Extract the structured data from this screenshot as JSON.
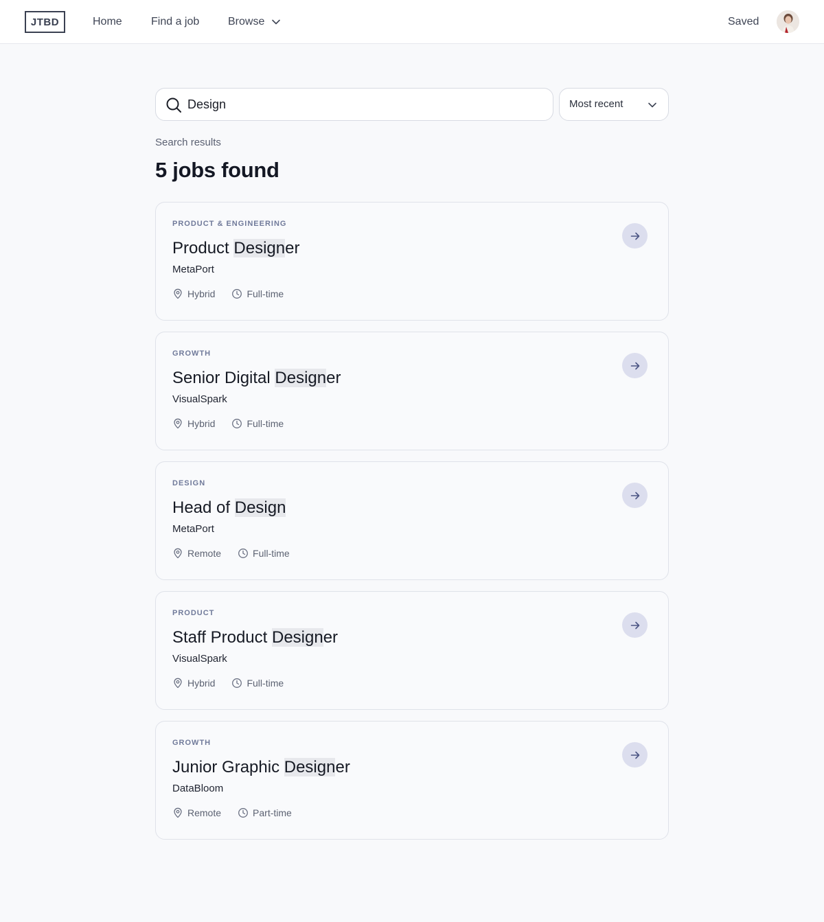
{
  "nav": {
    "logo": "JTBD",
    "home": "Home",
    "find_job": "Find a job",
    "browse": "Browse",
    "saved": "Saved"
  },
  "search": {
    "value": "Design",
    "sort": "Most recent"
  },
  "results": {
    "label": "Search results",
    "count": "5 jobs found"
  },
  "jobs": [
    {
      "category": "Product & Engineering",
      "title_pre": "Product ",
      "title_hl": "Design",
      "title_post": "er",
      "company": "MetaPort",
      "location": "Hybrid",
      "type": "Full-time"
    },
    {
      "category": "Growth",
      "title_pre": "Senior Digital ",
      "title_hl": "Design",
      "title_post": "er",
      "company": "VisualSpark",
      "location": "Hybrid",
      "type": "Full-time"
    },
    {
      "category": "Design",
      "title_pre": "Head of ",
      "title_hl": "Design",
      "title_post": "",
      "company": "MetaPort",
      "location": "Remote",
      "type": "Full-time"
    },
    {
      "category": "Product",
      "title_pre": "Staff Product ",
      "title_hl": "Design",
      "title_post": "er",
      "company": "VisualSpark",
      "location": "Hybrid",
      "type": "Full-time"
    },
    {
      "category": "Growth",
      "title_pre": "Junior Graphic ",
      "title_hl": "Design",
      "title_post": "er",
      "company": "DataBloom",
      "location": "Remote",
      "type": "Part-time"
    }
  ],
  "icons": {
    "search": "search-icon",
    "chevron": "chevron-down-icon",
    "location": "map-pin-icon",
    "clock": "clock-icon",
    "arrow": "arrow-right-icon"
  },
  "colors": {
    "accent_button": "#dcdeee",
    "arrow": "#4b5584",
    "category": "#707a9a"
  }
}
